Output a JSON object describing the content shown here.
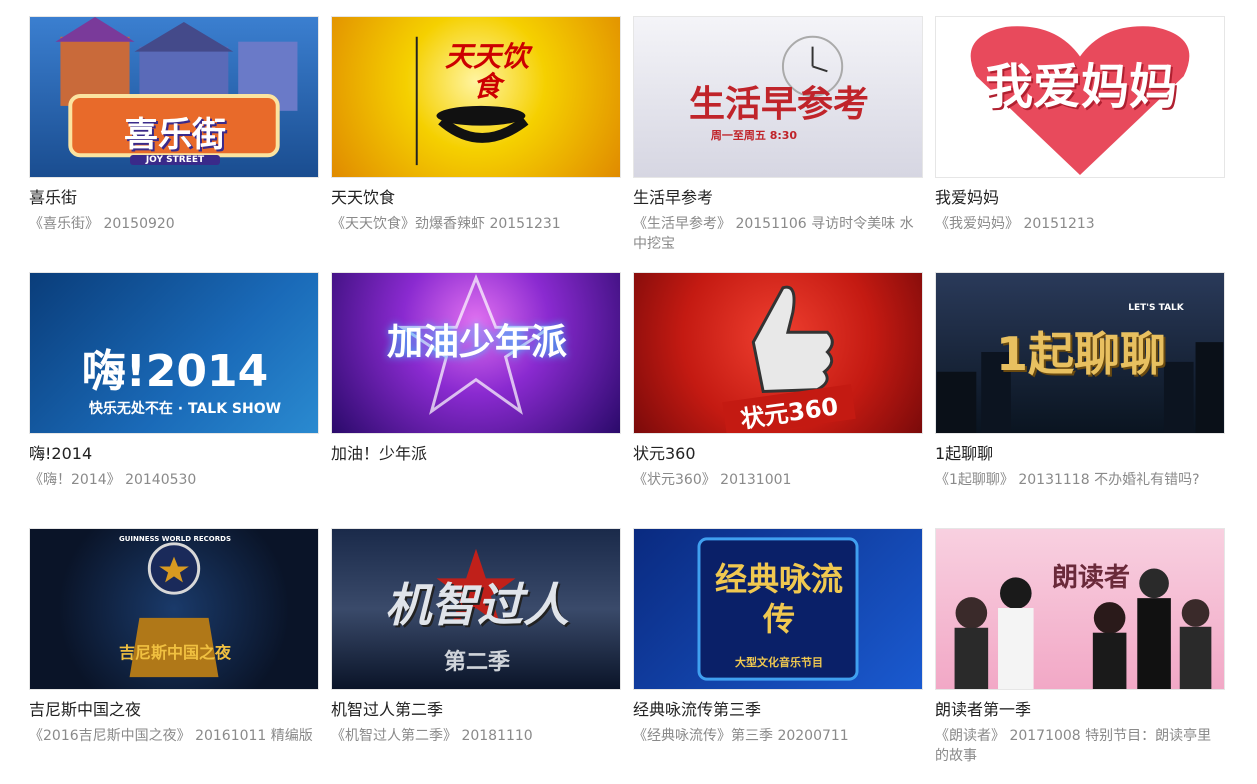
{
  "programs": [
    {
      "title": "喜乐街",
      "desc": "《喜乐街》 20150920",
      "logo": "喜乐街",
      "logo_sub": "JOY STREET",
      "colors": [
        "#2a5ea8",
        "#e07030"
      ],
      "icon": "house-thumbnail"
    },
    {
      "title": "天天饮食",
      "desc": "《天天饮食》劲爆香辣虾 20151231",
      "logo": "天天饮食",
      "logo_sub": "",
      "colors": [
        "#f5d000",
        "#f08a00"
      ],
      "icon": "bowl-thumbnail"
    },
    {
      "title": "生活早参考",
      "desc": "《生活早参考》 20151106 寻访时令美味 水中挖宝",
      "logo": "生活早参考",
      "logo_sub": "周一至周五 8:30",
      "colors": [
        "#e8e8ee",
        "#c0242a"
      ],
      "icon": "clock-thumbnail"
    },
    {
      "title": "我爱妈妈",
      "desc": "《我爱妈妈》 20151213",
      "logo": "我爱妈妈",
      "logo_sub": "",
      "colors": [
        "#ffffff",
        "#e84a5c"
      ],
      "icon": "heart-thumbnail"
    },
    {
      "title": "嗨!2014",
      "desc": "《嗨！2014》 20140530",
      "logo": "嗨!2014",
      "logo_sub": "快乐无处不在 · TALK SHOW",
      "colors": [
        "#0a3d7a",
        "#2a8ad0"
      ],
      "icon": "cctv-thumbnail"
    },
    {
      "title": "加油！少年派",
      "desc": "",
      "logo": "加油少年派",
      "logo_sub": "",
      "colors": [
        "#5a1ab0",
        "#d040c8"
      ],
      "icon": "star-thumbnail"
    },
    {
      "title": "状元360",
      "desc": "《状元360》 20131001",
      "logo": "状元360",
      "logo_sub": "",
      "colors": [
        "#d41e14",
        "#8a0a0a"
      ],
      "icon": "thumbs-up-thumbnail"
    },
    {
      "title": "1起聊聊",
      "desc": "《1起聊聊》 20131118 不办婚礼有错吗?",
      "logo": "1起聊聊",
      "logo_sub": "LET'S TALK",
      "colors": [
        "#1a2a40",
        "#c9a040"
      ],
      "icon": "city-thumbnail"
    },
    {
      "title": "吉尼斯中国之夜",
      "desc": "《2016吉尼斯中国之夜》 20161011 精编版",
      "logo": "吉尼斯中国之夜",
      "logo_sub": "GUINNESS WORLD RECORDS",
      "colors": [
        "#0a1e3a",
        "#d89a20"
      ],
      "icon": "trophy-thumbnail"
    },
    {
      "title": "机智过人第二季",
      "desc": "《机智过人第二季》 20181110",
      "logo": "机智过人",
      "logo_sub": "第二季",
      "colors": [
        "#1a2a4a",
        "#b0bac8"
      ],
      "icon": "star-thumbnail"
    },
    {
      "title": "经典咏流传第三季",
      "desc": "《经典咏流传》第三季 20200711",
      "logo": "经典咏流传",
      "logo_sub": "大型文化音乐节目",
      "colors": [
        "#0a2a80",
        "#f0c850"
      ],
      "icon": "frame-thumbnail"
    },
    {
      "title": "朗读者第一季",
      "desc": "《朗读者》 20171008 特别节目：朗读亭里的故事",
      "logo": "朗读者",
      "logo_sub": "",
      "colors": [
        "#f6c6d8",
        "#c02040"
      ],
      "icon": "people-thumbnail"
    }
  ]
}
